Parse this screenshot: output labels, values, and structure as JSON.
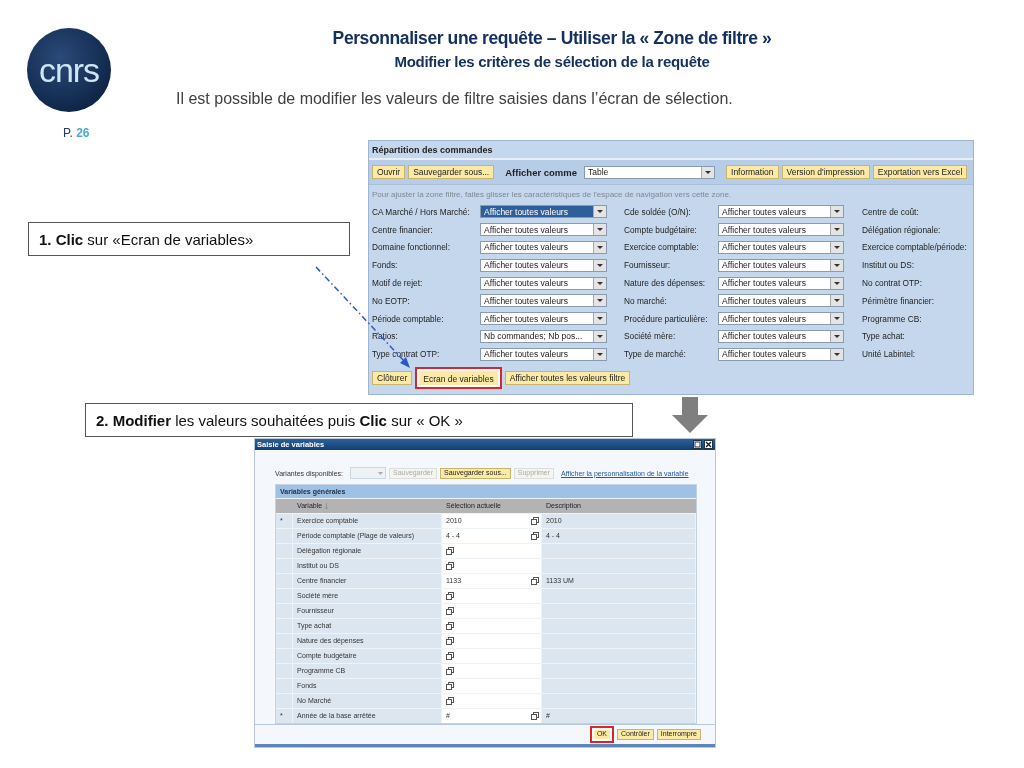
{
  "logo": {
    "text": "cnrs"
  },
  "page": {
    "label": "P.",
    "number": "26"
  },
  "title": "Personnaliser une requête – Utiliser la « Zone de filtre »",
  "subtitle": "Modifier les critères de sélection de la requête",
  "intro": "Il est possible de modifier les valeurs de filtre saisies dans l’écran de sélection.",
  "callouts": [
    {
      "text": "**1. Clic** sur «Ecran de variables»"
    },
    {
      "text": "**2. Modifier** les valeurs souhaitées puis **Clic** sur « OK »"
    }
  ],
  "report": {
    "title": "Répartition des commandes",
    "toolbar": [
      {
        "kind": "button",
        "label": "Ouvrir"
      },
      {
        "kind": "button",
        "label": "Sauvegarder sous..."
      },
      {
        "kind": "label",
        "label": "Afficher comme"
      },
      {
        "kind": "dropdown",
        "label": "Table"
      },
      {
        "kind": "button",
        "label": "Information"
      },
      {
        "kind": "button",
        "label": "Version d'impression"
      },
      {
        "kind": "button",
        "label": "Exportation vers Excel"
      }
    ],
    "hint": "Pour ajuster la zone filtre, faites glisser les caractéristiques de l'espace de navigation vers cette zone.",
    "rows": [
      {
        "cells": [
          {
            "label": "CA Marché / Hors Marché:",
            "value": "Afficher toutes valeurs",
            "focused": true
          },
          {
            "label": "Cde soldée (O/N):",
            "value": "Afficher toutes valeurs",
            "focused": false
          },
          {
            "label": "Centre de coût:"
          }
        ]
      },
      {
        "cells": [
          {
            "label": "Centre financier:",
            "value": "Afficher toutes valeurs",
            "focused": false
          },
          {
            "label": "Compte budgétaire:",
            "value": "Afficher toutes valeurs",
            "focused": false
          },
          {
            "label": "Délégation régionale:"
          }
        ]
      },
      {
        "cells": [
          {
            "label": "Domaine fonctionnel:",
            "value": "Afficher toutes valeurs",
            "focused": false
          },
          {
            "label": "Exercice comptable:",
            "value": "Afficher toutes valeurs",
            "focused": false
          },
          {
            "label": "Exercice comptable/période:"
          }
        ]
      },
      {
        "cells": [
          {
            "label": "Fonds:",
            "value": "Afficher toutes valeurs",
            "focused": false
          },
          {
            "label": "Fournisseur:",
            "value": "Afficher toutes valeurs",
            "focused": false
          },
          {
            "label": "Institut ou DS:"
          }
        ]
      },
      {
        "cells": [
          {
            "label": "Motif de rejet:",
            "value": "Afficher toutes valeurs",
            "focused": false
          },
          {
            "label": "Nature des dépenses:",
            "value": "Afficher toutes valeurs",
            "focused": false
          },
          {
            "label": "No contrat OTP:"
          }
        ]
      },
      {
        "cells": [
          {
            "label": "No EOTP:",
            "value": "Afficher toutes valeurs",
            "focused": false
          },
          {
            "label": "No marché:",
            "value": "Afficher toutes valeurs",
            "focused": false
          },
          {
            "label": "Périmètre financier:"
          }
        ]
      },
      {
        "cells": [
          {
            "label": "Période comptable:",
            "value": "Afficher toutes valeurs",
            "focused": false
          },
          {
            "label": "Procédure particulière:",
            "value": "Afficher toutes valeurs",
            "focused": false
          },
          {
            "label": "Programme CB:"
          }
        ]
      },
      {
        "cells": [
          {
            "label": "Ratios:",
            "value": "Nb commandes; Nb pos...",
            "focused": false
          },
          {
            "label": "Société mère:",
            "value": "Afficher toutes valeurs",
            "focused": false
          },
          {
            "label": "Type achat:"
          }
        ]
      },
      {
        "cells": [
          {
            "label": "Type contrat OTP:",
            "value": "Afficher toutes valeurs",
            "focused": false
          },
          {
            "label": "Type de marché:",
            "value": "Afficher toutes valeurs",
            "focused": false
          },
          {
            "label": "Unité Labintel:"
          }
        ]
      }
    ],
    "buttons": [
      {
        "label": "Clôturer",
        "highlighted": false
      },
      {
        "label": "Ecran de variables",
        "highlighted": true
      },
      {
        "label": "Afficher toutes les valeurs filtre",
        "highlighted": false
      }
    ]
  },
  "dialog": {
    "title": "Saisie de variables",
    "variants_label": "Variantes disponibles:",
    "variant_buttons": [
      {
        "label": "Sauvegarder",
        "disabled": true
      },
      {
        "label": "Sauvegarder sous...",
        "disabled": false
      },
      {
        "label": "Supprimer",
        "disabled": true
      }
    ],
    "link": "Afficher la personnalisation de la variable",
    "section_title": "Variables générales",
    "columns": [
      "Variable",
      "Sélection actuelle",
      "Description"
    ],
    "rows": [
      {
        "marker": "*",
        "variable": "Exercice comptable",
        "selection": "2010",
        "description": "2010"
      },
      {
        "variable": "Période comptable (Plage de valeurs)",
        "selection": "4 - 4",
        "description": "4 - 4"
      },
      {
        "variable": "Délégation régionale"
      },
      {
        "variable": "Institut ou DS"
      },
      {
        "variable": "Centre financier",
        "selection": "1133",
        "description": "1133 UM"
      },
      {
        "variable": "Société mère"
      },
      {
        "variable": "Fournisseur"
      },
      {
        "variable": "Type achat"
      },
      {
        "variable": "Nature des dépenses"
      },
      {
        "variable": "Compte budgétaire"
      },
      {
        "variable": "Programme CB"
      },
      {
        "variable": "Fonds"
      },
      {
        "variable": "No Marché"
      },
      {
        "marker": "*",
        "variable": "Année de la base arrêtée",
        "selection": "#",
        "description": "#"
      }
    ],
    "buttons": [
      {
        "label": "OK",
        "highlighted": true
      },
      {
        "label": "Contrôler",
        "highlighted": false
      },
      {
        "label": "Interrompre",
        "highlighted": false
      }
    ]
  }
}
